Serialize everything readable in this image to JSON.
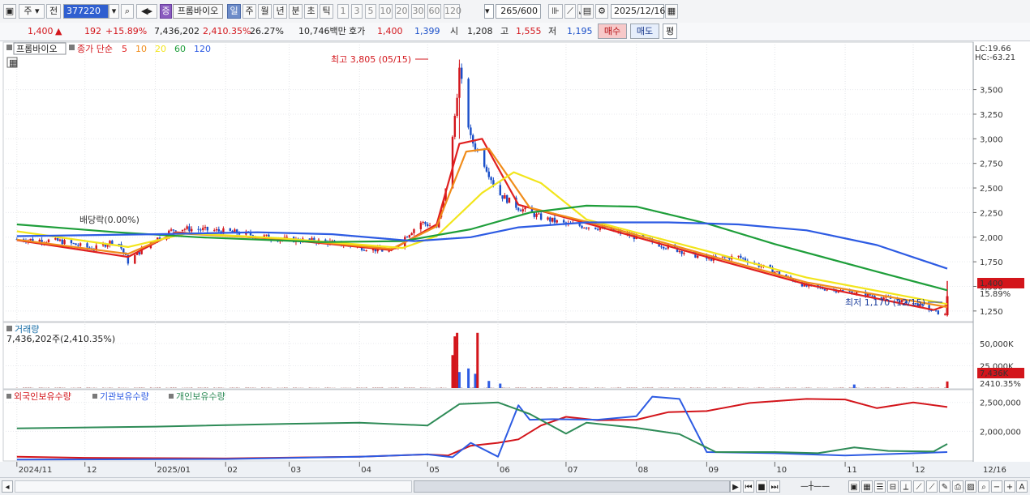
{
  "toolbar": {
    "period_select": "주",
    "scope_select": "전",
    "stock_code": "377220",
    "stock_badge": "증",
    "stock_name": "프롬바이오",
    "period_tabs": [
      "일",
      "주",
      "월",
      "년",
      "분",
      "초",
      "틱"
    ],
    "interval_buttons": [
      "1",
      "3",
      "5",
      "10",
      "20",
      "30",
      "60",
      "120"
    ],
    "count_value": "265",
    "count_total": "/600",
    "date_value": "2025/12/16"
  },
  "quote": {
    "price": "1,400",
    "change_arrow": "▲",
    "change": "192",
    "change_pct": "+15.89%",
    "volume": "7,436,202",
    "volume_pct": "2,410.35%",
    "turnover": "26.27%",
    "amount": "10,746백만",
    "hoga_label": "호가",
    "ask": "1,400",
    "bid": "1,399",
    "open_label": "시",
    "open": "1,208",
    "high_label": "고",
    "high": "1,555",
    "low_label": "저",
    "low": "1,195",
    "buy_button": "매수",
    "sell_button": "매도",
    "eval_button": "평"
  },
  "price_panel": {
    "stock_tag": "프롬바이오",
    "ma_label": "종가 단순",
    "ma_periods": [
      "5",
      "10",
      "20",
      "60",
      "120"
    ],
    "ma_colors": [
      "#e02020",
      "#f08c1a",
      "#f2e51c",
      "#1e9e3a",
      "#2d5be3"
    ],
    "lc_label": "LC:19.66",
    "hc_label": "HC:-63.21",
    "high_annot": "최고 3,805 (05/15)",
    "low_annot": "최저 1,170 (12/15)",
    "dividend_annot": "배당락(0.00%)",
    "current_price_tag": "1,400",
    "current_pct_tag": "15.89%",
    "y_ticks": [
      "3,500",
      "3,250",
      "3,000",
      "2,750",
      "2,500",
      "2,250",
      "2,000",
      "1,750",
      "1,500",
      "1,250"
    ]
  },
  "volume_panel": {
    "title": "거래량",
    "info": "7,436,202주(2,410.35%)",
    "y_ticks": [
      "50,000K",
      "25,000K"
    ],
    "current_tag": "7,436K",
    "current_pct": "2410.35%"
  },
  "holdings_panel": {
    "legend": [
      {
        "name": "외국인보유수량",
        "color": "#d3151b"
      },
      {
        "name": "기관보유수량",
        "color": "#2d5be3"
      },
      {
        "name": "개인보유수량",
        "color": "#2e8b57"
      }
    ],
    "y_ticks": [
      "2,500,000",
      "2,000,000"
    ]
  },
  "x_axis": {
    "labels": [
      "2024/11",
      "12",
      "2025/01",
      "02",
      "03",
      "04",
      "05",
      "06",
      "07",
      "08",
      "09",
      "10",
      "11",
      "12"
    ],
    "right_label": "12/16"
  },
  "chart_data": {
    "type": "line",
    "x_label_dates": [
      "2024/11",
      "12",
      "2025/01",
      "02",
      "03",
      "04",
      "05",
      "06",
      "07",
      "08",
      "09",
      "10",
      "11",
      "12"
    ],
    "price_series": {
      "name": "종가",
      "points": [
        [
          "2024-11-01",
          1980
        ],
        [
          "2024-11-20",
          1960
        ],
        [
          "2024-12-05",
          1880
        ],
        [
          "2024-12-15",
          1980
        ],
        [
          "2024-12-20",
          1750
        ],
        [
          "2024-12-30",
          1950
        ],
        [
          "2025-01-10",
          2090
        ],
        [
          "2025-01-20",
          2080
        ],
        [
          "2025-02-05",
          2050
        ],
        [
          "2025-02-25",
          1980
        ],
        [
          "2025-03-15",
          1960
        ],
        [
          "2025-04-01",
          1900
        ],
        [
          "2025-04-15",
          1850
        ],
        [
          "2025-04-20",
          1980
        ],
        [
          "2025-04-28",
          2150
        ],
        [
          "2025-05-05",
          2100
        ],
        [
          "2025-05-08",
          2350
        ],
        [
          "2025-05-12",
          3000
        ],
        [
          "2025-05-15",
          3700
        ],
        [
          "2025-05-20",
          3000
        ],
        [
          "2025-05-25",
          2800
        ],
        [
          "2025-06-01",
          2450
        ],
        [
          "2025-06-10",
          2300
        ],
        [
          "2025-06-20",
          2200
        ],
        [
          "2025-07-01",
          2130
        ],
        [
          "2025-07-15",
          2100
        ],
        [
          "2025-08-01",
          2000
        ],
        [
          "2025-08-15",
          1900
        ],
        [
          "2025-09-01",
          1780
        ],
        [
          "2025-09-15",
          1800
        ],
        [
          "2025-10-01",
          1650
        ],
        [
          "2025-10-15",
          1500
        ],
        [
          "2025-11-01",
          1450
        ],
        [
          "2025-11-15",
          1400
        ],
        [
          "2025-12-01",
          1330
        ],
        [
          "2025-12-12",
          1230
        ],
        [
          "2025-12-15",
          1208
        ],
        [
          "2025-12-16",
          1400
        ]
      ]
    },
    "moving_averages": [
      {
        "name": "5",
        "points": [
          [
            "2024-11-01",
            1970
          ],
          [
            "2024-12-20",
            1800
          ],
          [
            "2025-01-10",
            2050
          ],
          [
            "2025-02-25",
            1980
          ],
          [
            "2025-04-15",
            1870
          ],
          [
            "2025-05-05",
            2130
          ],
          [
            "2025-05-15",
            2950
          ],
          [
            "2025-05-25",
            3000
          ],
          [
            "2025-06-10",
            2330
          ],
          [
            "2025-07-15",
            2110
          ],
          [
            "2025-09-01",
            1800
          ],
          [
            "2025-10-15",
            1520
          ],
          [
            "2025-12-10",
            1260
          ],
          [
            "2025-12-16",
            1310
          ]
        ]
      },
      {
        "name": "10",
        "points": [
          [
            "2024-11-01",
            1975
          ],
          [
            "2024-12-20",
            1830
          ],
          [
            "2025-01-10",
            2040
          ],
          [
            "2025-02-25",
            1985
          ],
          [
            "2025-04-15",
            1880
          ],
          [
            "2025-05-05",
            2110
          ],
          [
            "2025-05-18",
            2870
          ],
          [
            "2025-05-28",
            2900
          ],
          [
            "2025-06-15",
            2300
          ],
          [
            "2025-07-20",
            2100
          ],
          [
            "2025-09-01",
            1820
          ],
          [
            "2025-10-15",
            1540
          ],
          [
            "2025-12-16",
            1290
          ]
        ]
      },
      {
        "name": "20",
        "points": [
          [
            "2024-11-01",
            2060
          ],
          [
            "2024-12-20",
            1900
          ],
          [
            "2025-01-15",
            2040
          ],
          [
            "2025-02-25",
            1990
          ],
          [
            "2025-04-20",
            1890
          ],
          [
            "2025-05-05",
            2010
          ],
          [
            "2025-05-25",
            2450
          ],
          [
            "2025-06-08",
            2660
          ],
          [
            "2025-06-20",
            2550
          ],
          [
            "2025-07-10",
            2180
          ],
          [
            "2025-09-01",
            1860
          ],
          [
            "2025-10-15",
            1590
          ],
          [
            "2025-12-16",
            1320
          ]
        ]
      },
      {
        "name": "60",
        "points": [
          [
            "2024-11-01",
            2130
          ],
          [
            "2024-12-15",
            2050
          ],
          [
            "2025-01-20",
            2000
          ],
          [
            "2025-03-15",
            1950
          ],
          [
            "2025-04-20",
            1960
          ],
          [
            "2025-05-20",
            2080
          ],
          [
            "2025-06-15",
            2250
          ],
          [
            "2025-07-10",
            2320
          ],
          [
            "2025-08-01",
            2310
          ],
          [
            "2025-09-01",
            2140
          ],
          [
            "2025-10-01",
            1930
          ],
          [
            "2025-11-15",
            1650
          ],
          [
            "2025-12-16",
            1460
          ]
        ]
      },
      {
        "name": "120",
        "points": [
          [
            "2024-11-01",
            2010
          ],
          [
            "2025-01-01",
            2030
          ],
          [
            "2025-02-15",
            2050
          ],
          [
            "2025-03-20",
            2030
          ],
          [
            "2025-04-25",
            1960
          ],
          [
            "2025-05-20",
            2000
          ],
          [
            "2025-06-10",
            2100
          ],
          [
            "2025-07-10",
            2150
          ],
          [
            "2025-08-15",
            2150
          ],
          [
            "2025-09-15",
            2130
          ],
          [
            "2025-10-15",
            2070
          ],
          [
            "2025-11-15",
            1920
          ],
          [
            "2025-12-16",
            1680
          ]
        ]
      }
    ],
    "volume_spikes_k": [
      [
        "2025-05-12",
        37000
      ],
      [
        "2025-05-13",
        58000
      ],
      [
        "2025-05-14",
        62000
      ],
      [
        "2025-05-15",
        18000
      ],
      [
        "2025-05-19",
        22000
      ],
      [
        "2025-05-22",
        16000
      ],
      [
        "2025-05-23",
        62000
      ],
      [
        "2025-05-28",
        8000
      ],
      [
        "2025-06-02",
        5000
      ],
      [
        "2025-11-05",
        4000
      ],
      [
        "2025-12-16",
        7436
      ]
    ],
    "holdings_series": [
      {
        "name": "외국인보유수량",
        "points": [
          [
            "2024-11-01",
            1560
          ],
          [
            "2024-12-01",
            1540
          ],
          [
            "2025-02-01",
            1530
          ],
          [
            "2025-04-01",
            1560
          ],
          [
            "2025-05-01",
            1600
          ],
          [
            "2025-05-10",
            1580
          ],
          [
            "2025-05-20",
            1750
          ],
          [
            "2025-06-01",
            1800
          ],
          [
            "2025-06-10",
            1860
          ],
          [
            "2025-06-20",
            2100
          ],
          [
            "2025-07-01",
            2250
          ],
          [
            "2025-07-15",
            2190
          ],
          [
            "2025-08-01",
            2200
          ],
          [
            "2025-08-15",
            2330
          ],
          [
            "2025-09-01",
            2350
          ],
          [
            "2025-09-20",
            2490
          ],
          [
            "2025-10-15",
            2560
          ],
          [
            "2025-11-01",
            2550
          ],
          [
            "2025-11-15",
            2400
          ],
          [
            "2025-12-01",
            2500
          ],
          [
            "2025-12-16",
            2420
          ]
        ]
      },
      {
        "name": "기관보유수량",
        "points": [
          [
            "2024-11-01",
            1510
          ],
          [
            "2025-02-01",
            1520
          ],
          [
            "2025-04-01",
            1560
          ],
          [
            "2025-05-01",
            1600
          ],
          [
            "2025-05-12",
            1550
          ],
          [
            "2025-05-20",
            1800
          ],
          [
            "2025-06-01",
            1560
          ],
          [
            "2025-06-10",
            2450
          ],
          [
            "2025-06-15",
            2200
          ],
          [
            "2025-06-25",
            2210
          ],
          [
            "2025-07-15",
            2200
          ],
          [
            "2025-08-01",
            2260
          ],
          [
            "2025-08-08",
            2600
          ],
          [
            "2025-08-20",
            2560
          ],
          [
            "2025-09-01",
            1640
          ],
          [
            "2025-10-01",
            1620
          ],
          [
            "2025-11-01",
            1580
          ],
          [
            "2025-12-16",
            1640
          ]
        ]
      },
      {
        "name": "개인보유수량",
        "points": [
          [
            "2024-11-01",
            2050
          ],
          [
            "2025-01-01",
            2080
          ],
          [
            "2025-03-01",
            2130
          ],
          [
            "2025-04-01",
            2150
          ],
          [
            "2025-05-01",
            2100
          ],
          [
            "2025-05-15",
            2470
          ],
          [
            "2025-06-01",
            2500
          ],
          [
            "2025-06-15",
            2300
          ],
          [
            "2025-07-01",
            1960
          ],
          [
            "2025-07-10",
            2150
          ],
          [
            "2025-08-01",
            2060
          ],
          [
            "2025-08-20",
            1950
          ],
          [
            "2025-09-05",
            1640
          ],
          [
            "2025-10-01",
            1640
          ],
          [
            "2025-10-20",
            1620
          ],
          [
            "2025-11-05",
            1720
          ],
          [
            "2025-11-20",
            1660
          ],
          [
            "2025-12-10",
            1650
          ],
          [
            "2025-12-16",
            1780
          ]
        ]
      }
    ],
    "price_ylim": [
      1150,
      3900
    ],
    "holdings_ylim": [
      1500,
      2650
    ],
    "title": "",
    "xlabel": "",
    "ylabel": ""
  }
}
